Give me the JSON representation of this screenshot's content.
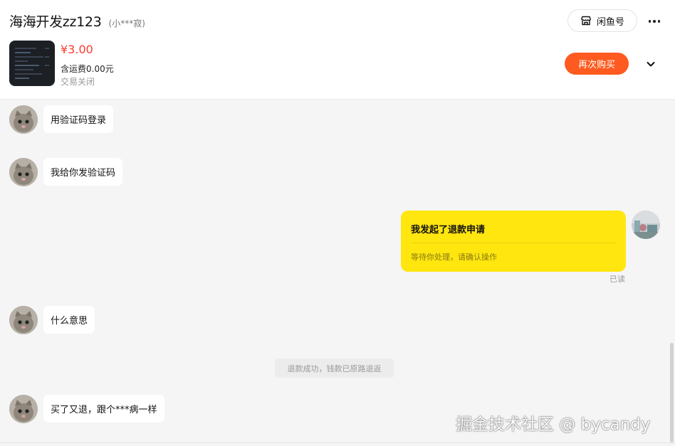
{
  "header": {
    "title": "海海开发zz123",
    "subtitle": "(小***寂)",
    "shop_label": "闲鱼号"
  },
  "order": {
    "price": "¥3.00",
    "shipping": "含运费0.00元",
    "status": "交易关闭",
    "rebuy_label": "再次购买"
  },
  "messages": [
    {
      "from": "other",
      "text": "用验证码登录"
    },
    {
      "from": "other",
      "text": "我给你发验证码"
    },
    {
      "from": "other",
      "text": "什么意思"
    },
    {
      "from": "other",
      "text": "买了又退，跟个***病一样"
    }
  ],
  "refund_card": {
    "title": "我发起了退款申请",
    "subtitle": "等待你处理，请确认操作",
    "read_status": "已读"
  },
  "system_note": "退款成功，钱款已原路退返",
  "watermark": "掘金技术社区 @ bycandy",
  "colors": {
    "accent": "#ff5a1f",
    "price": "#ff3b30",
    "card": "#ffe60f"
  },
  "icons": [
    "shop-icon",
    "more-icon",
    "chevron-down-icon"
  ]
}
